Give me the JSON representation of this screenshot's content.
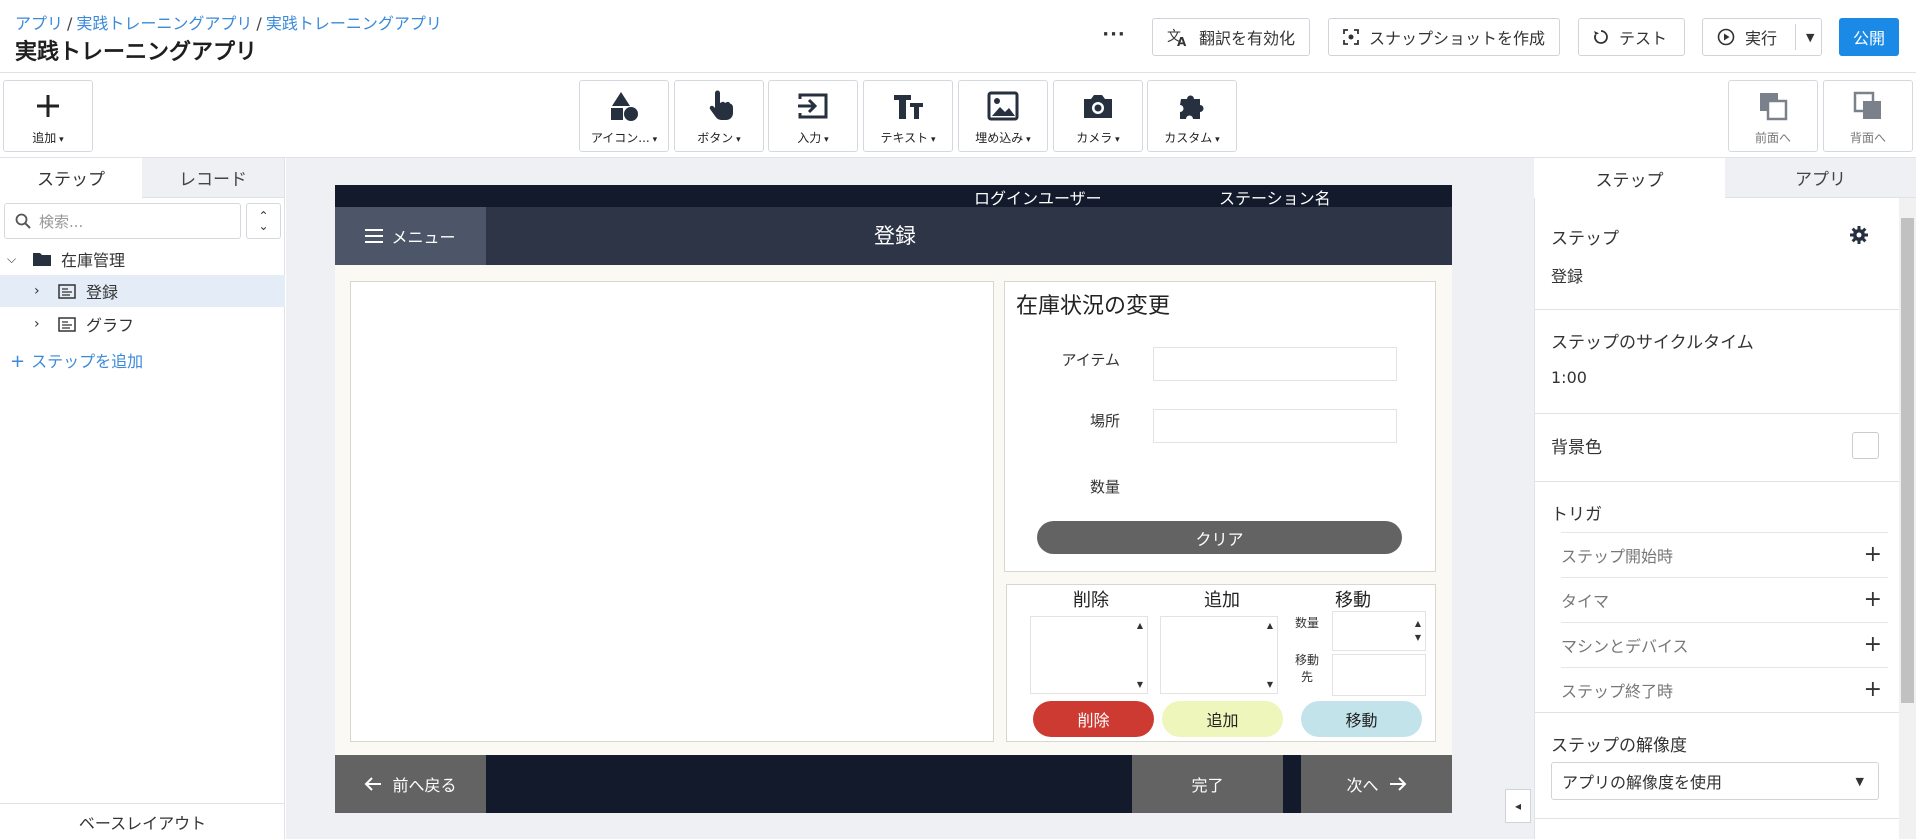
{
  "header": {
    "breadcrumb": [
      "アプリ",
      "実践トレーニングアプリ",
      "実践トレーニングアプリ"
    ],
    "breadcrumb_sep": "/",
    "title": "実践トレーニングアプリ",
    "more": "···",
    "translate_label": "翻訳を有効化",
    "snapshot_label": "スナップショットを作成",
    "test_label": "テスト",
    "run_label": "実行",
    "publish_label": "公開"
  },
  "toolbar": {
    "add_label": "追加",
    "tools": [
      {
        "label": "アイコン...",
        "icon": "shapes-icon"
      },
      {
        "label": "ボタン",
        "icon": "pointer-hand-icon"
      },
      {
        "label": "入力",
        "icon": "input-icon"
      },
      {
        "label": "テキスト",
        "icon": "text-icon"
      },
      {
        "label": "埋め込み",
        "icon": "image-icon"
      },
      {
        "label": "カメラ",
        "icon": "camera-icon"
      },
      {
        "label": "カスタム",
        "icon": "puzzle-icon"
      }
    ],
    "bring_front_label": "前面へ",
    "send_back_label": "背面へ"
  },
  "left_panel": {
    "tabs": [
      "ステップ",
      "レコード"
    ],
    "search_placeholder": "検索...",
    "sort_up": "⌃",
    "sort_down": "⌄",
    "tree": {
      "folder": "在庫管理",
      "steps": [
        "登録",
        "グラフ"
      ]
    },
    "add_step_label": "ステップを追加",
    "base_layout_label": "ベースレイアウト"
  },
  "app_canvas": {
    "top_user": "ログインユーザー",
    "top_station": "ステーション名",
    "menu_label": "メニュー",
    "step_title": "登録",
    "inventory_title": "在庫状況の変更",
    "fields": {
      "item": "アイテム",
      "location": "場所",
      "quantity": "数量"
    },
    "clear_label": "クリア",
    "actions": {
      "delete_head": "削除",
      "add_head": "追加",
      "move_head": "移動",
      "qty_label": "数量",
      "dest_label_1": "移動",
      "dest_label_2": "先",
      "delete_btn": "削除",
      "add_btn": "追加",
      "move_btn": "移動"
    },
    "footer": {
      "back_label": "前へ戻る",
      "done_label": "完了",
      "next_label": "次へ"
    }
  },
  "right_panel": {
    "tabs": [
      "ステップ",
      "アプリ"
    ],
    "step_label": "ステップ",
    "step_value": "登録",
    "cycle_label": "ステップのサイクルタイム",
    "cycle_value": "1:00",
    "bg_label": "背景色",
    "trigger_label": "トリガ",
    "triggers": [
      "ステップ開始時",
      "タイマ",
      "マシンとデバイス",
      "ステップ終了時"
    ],
    "resolution_label": "ステップの解像度",
    "resolution_value": "アプリの解像度を使用"
  },
  "colors": {
    "accent": "#1a8ae6",
    "link": "#3a8ad9",
    "app_dark": "#131a2c",
    "delete_btn": "#cc3a32",
    "add_btn": "#eef6bb",
    "move_btn": "#c3e3ea"
  }
}
